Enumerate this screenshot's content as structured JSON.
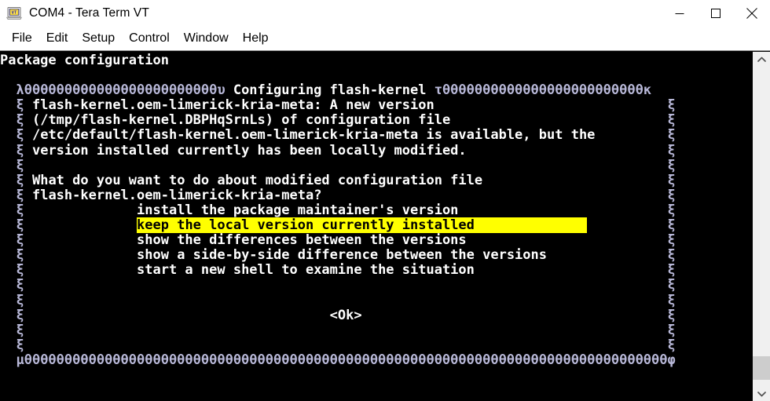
{
  "window": {
    "title": "COM4 - Tera Term VT",
    "icon": "tera-term-icon",
    "controls": {
      "minimize": "minimize-icon",
      "maximize": "maximize-icon",
      "close": "close-icon"
    }
  },
  "menu": {
    "items": [
      {
        "label": "File"
      },
      {
        "label": "Edit"
      },
      {
        "label": "Setup"
      },
      {
        "label": "Control"
      },
      {
        "label": "Window"
      },
      {
        "label": "Help"
      }
    ]
  },
  "terminal": {
    "colors": {
      "background": "#000000",
      "foreground": "#ffffff",
      "highlight_bg": "#ffff00",
      "highlight_fg": "#000000",
      "border_glyph": "#b8b8d8"
    },
    "header": "Package configuration",
    "dialog": {
      "top_border_left": "λ",
      "top_border_fill": "θθθθθθθθθθθθθθθθθθθθθθθθ",
      "top_border_left_cap": "υ",
      "title": " Configuring flash-kernel ",
      "top_border_right_cap": "τ",
      "top_border_fill_right": "θθθθθθθθθθθθθθθθθθθθθθθθθ",
      "top_border_right": "κ",
      "side_glyph": "ξ",
      "bottom_border_left": "μ",
      "bottom_border_fill": "θθθθθθθθθθθθθθθθθθθθθθθθθθθθθθθθθθθθθθθθθθθθθθθθθθθθθθθθθθθθθθθθθθθθθθθθθθθθθθθθ",
      "bottom_border_right": "φ",
      "body_lines": [
        "flash-kernel.oem-limerick-kria-meta: A new version",
        "(/tmp/flash-kernel.DBPHqSrnLs) of configuration file",
        "/etc/default/flash-kernel.oem-limerick-kria-meta is available, but the",
        "version installed currently has been locally modified.",
        "",
        "What do you want to do about modified configuration file",
        "flash-kernel.oem-limerick-kria-meta?"
      ],
      "options": [
        {
          "label": "install the package maintainer's version",
          "selected": false
        },
        {
          "label": "keep the local version currently installed",
          "selected": true
        },
        {
          "label": "show the differences between the versions",
          "selected": false
        },
        {
          "label": "show a side-by-side difference between the versions",
          "selected": false
        },
        {
          "label": "start a new shell to examine the situation",
          "selected": false
        }
      ],
      "ok_button": "<Ok>"
    }
  },
  "scrollbar": {
    "up_arrow": "chevron-up-icon",
    "down_arrow": "chevron-down-icon"
  }
}
